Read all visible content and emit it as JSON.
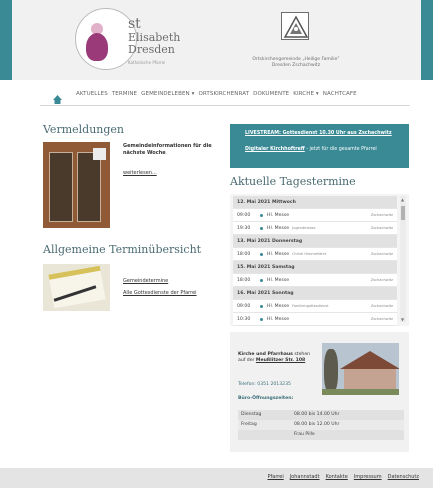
{
  "brand": {
    "line1": "st",
    "line2": "Elisabeth",
    "line3": "Dresden",
    "subtitle": "Katholische Pfarrei"
  },
  "parish": {
    "name_line1": "Ortskirchengemeinde „Heilige Familie“",
    "name_line2": "Dresden Zschachwitz"
  },
  "nav": {
    "items": [
      "AKTUELLES",
      "TERMINE",
      "GEMEINDELEBEN ▾",
      "ORTSKIRCHENRAT",
      "DOKUMENTE",
      "KIRCHE ▾",
      "NACHTCAFE"
    ]
  },
  "vermeldungen": {
    "heading": "Vermeldungen",
    "title": "Gemeindeinformationen für die nächste Woche",
    "link": "weiterlesen..."
  },
  "allgemeine": {
    "heading": "Allgemeine Terminübersicht",
    "link1": "Gemeindetermine",
    "link2": "Alle Gottesdienste der Pfarrei"
  },
  "livebox": {
    "line1_link": "LIVESTREAM: Gottesdienst 10.30 Uhr aus Zschachwitz",
    "line2_link": "Digitaler Kirchhoftreff",
    "line2_rest": " - jetzt für die gesamte Pfarrei"
  },
  "tagestermine": {
    "heading": "Aktuelle Tagestermine",
    "rows": [
      {
        "kind": "date",
        "text": "12. Mai 2021   Mittwoch"
      },
      {
        "kind": "event",
        "time": "09:00",
        "title": "Hl. Messe",
        "sub": "",
        "loc": "Zschachwitz"
      },
      {
        "kind": "event",
        "time": "19:30",
        "title": "Hl. Messe",
        "sub": "Jugendmesse",
        "loc": "Zschachwitz"
      },
      {
        "kind": "date",
        "text": "13. Mai 2021   Donnerstag"
      },
      {
        "kind": "event",
        "time": "18:00",
        "title": "Hl. Messe",
        "sub": "Christi Himmelfahrt",
        "loc": "Zschachwitz"
      },
      {
        "kind": "date",
        "text": "15. Mai 2021   Samstag"
      },
      {
        "kind": "event",
        "time": "18:00",
        "title": "Hl. Messe",
        "sub": "",
        "loc": "Zschachwitz"
      },
      {
        "kind": "date",
        "text": "16. Mai 2021   Sonntag"
      },
      {
        "kind": "event",
        "time": "09:00",
        "title": "Hl. Messe",
        "sub": "Familiengottesdienst",
        "loc": "Zschachwitz"
      },
      {
        "kind": "event",
        "time": "10:30",
        "title": "Hl. Messe",
        "sub": "",
        "loc": "Zschachwitz"
      }
    ]
  },
  "contact": {
    "label_bold": "Kirche und Pfarrhaus",
    "label_rest": " stehen auf der ",
    "address": "Meußlitzer Str. 108",
    "phone": "Telefon: 0351 2013235",
    "hours_heading": "Büro-Öffnungszeiten:",
    "hours": [
      {
        "day": "Dienstag",
        "time": "08.00 bis 14.00 Uhr"
      },
      {
        "day": "Freitag",
        "time": "08.00 bis 12.00 Uhr"
      },
      {
        "day": "",
        "time": "Frau Pille"
      }
    ]
  },
  "footer": {
    "links": [
      "Pfarrei",
      "Johannstadt",
      "Kontakte",
      "Impressum",
      "Datenschutz"
    ]
  }
}
